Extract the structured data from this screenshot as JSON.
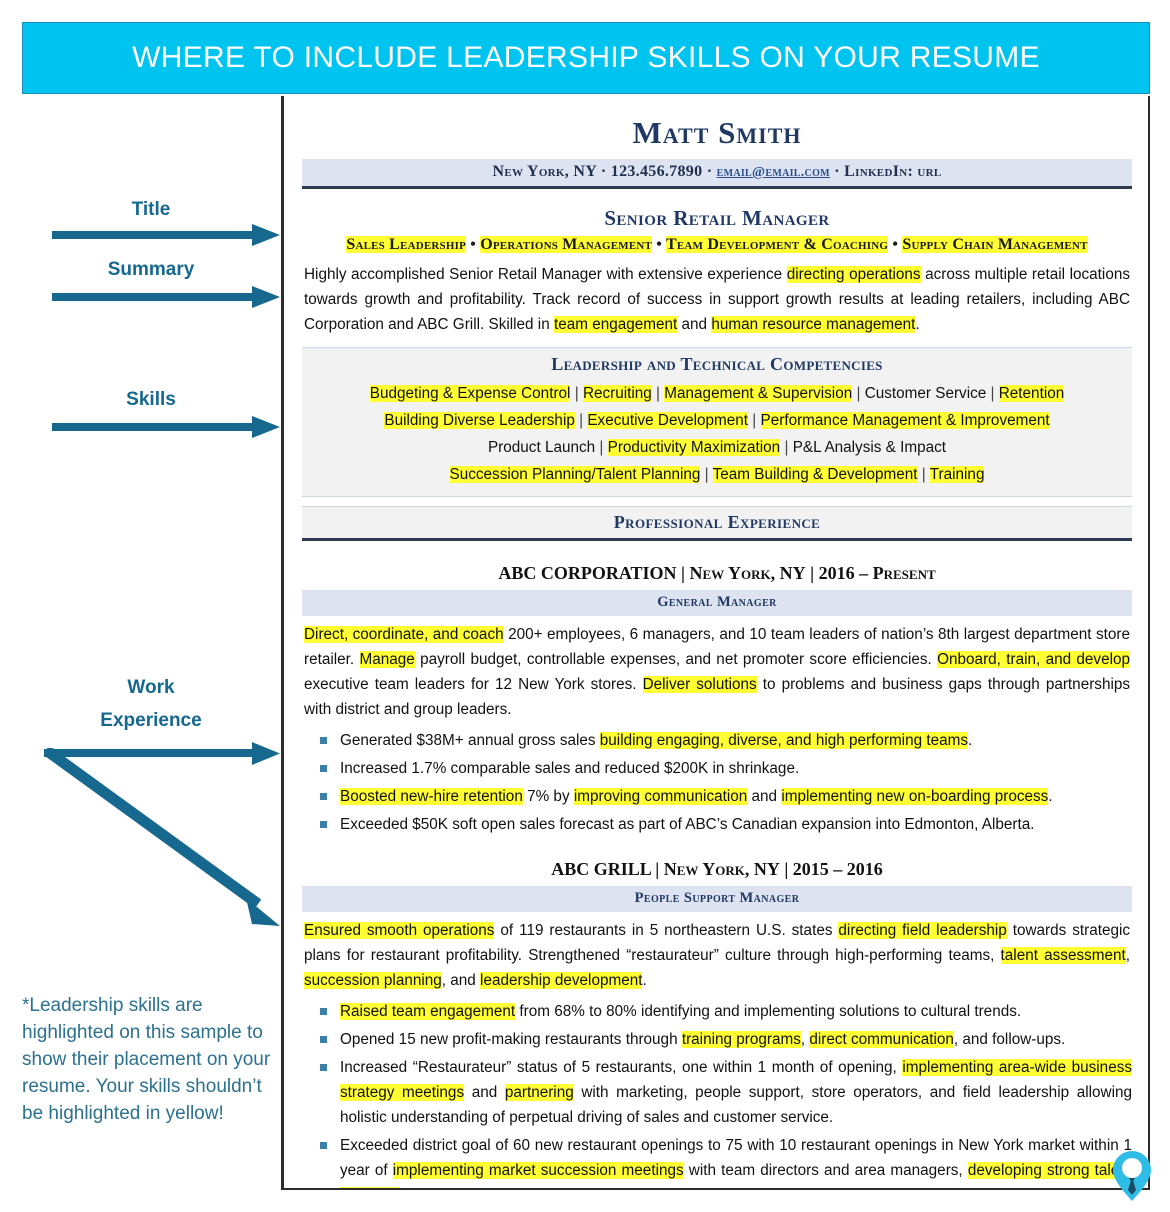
{
  "banner": {
    "title": "WHERE TO INCLUDE LEADERSHIP SKILLS ON YOUR RESUME",
    "bg_color": "#00c4f0",
    "text_color": "#ffffff"
  },
  "annotations": {
    "accent_color": "#15688f",
    "labels": [
      {
        "text": "Title"
      },
      {
        "text": "Summary"
      },
      {
        "text": "Skills"
      },
      {
        "text": "Work"
      },
      {
        "text": "Experience"
      }
    ],
    "note": "*Leadership skills are highlighted on this sample to show their placement on your resume. Your skills shouldn’t be highlighted in yellow!"
  },
  "resume": {
    "name": "Matt Smith",
    "contact": {
      "location": "New York, NY",
      "sep": "·",
      "phone": "123.456.7890",
      "email": "email@email.com",
      "linkedin": "LinkedIn: url"
    },
    "job_title": "Senior Retail Manager",
    "specialties": [
      {
        "text": "Sales Leadership",
        "highlight": true
      },
      {
        "text": "Operations Management",
        "highlight": true
      },
      {
        "text": "Team Development & Coaching",
        "highlight": true
      },
      {
        "text": "Supply Chain Management",
        "highlight": true
      }
    ],
    "specialty_sep": "•",
    "summary_parts": [
      {
        "text": "Highly accomplished Senior Retail Manager with extensive experience ",
        "highlight": false
      },
      {
        "text": "directing operations",
        "highlight": true
      },
      {
        "text": " across multiple retail locations towards growth and profitability. Track record of success in support growth results at leading retailers, including ABC Corporation and ABC Grill. Skilled in ",
        "highlight": false
      },
      {
        "text": "team engagement",
        "highlight": true
      },
      {
        "text": " and ",
        "highlight": false
      },
      {
        "text": "human resource management",
        "highlight": true
      },
      {
        "text": ".",
        "highlight": false
      }
    ],
    "competencies": {
      "heading": "Leadership and Technical Competencies",
      "rows": [
        [
          {
            "text": "Budgeting & Expense Control",
            "highlight": true
          },
          {
            "text": "Recruiting",
            "highlight": true
          },
          {
            "text": "Management & Supervision",
            "highlight": true
          },
          {
            "text": "Customer Service",
            "highlight": false
          },
          {
            "text": "Retention",
            "highlight": true
          }
        ],
        [
          {
            "text": "Building Diverse Leadership",
            "highlight": true
          },
          {
            "text": "Executive Development",
            "highlight": true
          },
          {
            "text": "Performance Management & Improvement",
            "highlight": true
          }
        ],
        [
          {
            "text": "Product Launch",
            "highlight": false
          },
          {
            "text": "Productivity Maximization",
            "highlight": true
          },
          {
            "text": "P&L Analysis & Impact",
            "highlight": false
          }
        ],
        [
          {
            "text": "Succession Planning/Talent Planning",
            "highlight": true
          },
          {
            "text": "Team Building & Development",
            "highlight": true
          },
          {
            "text": "Training",
            "highlight": true
          }
        ]
      ],
      "separator": "|"
    },
    "experience_heading": "Professional Experience",
    "jobs": [
      {
        "company": "ABC CORPORATION",
        "location": "New York, NY",
        "dates": "2016 – Present",
        "role": "General Manager",
        "paragraph_parts": [
          {
            "text": "Direct, coordinate, and coach",
            "highlight": true
          },
          {
            "text": " 200+ employees, 6 managers, and 10 team leaders of nation’s 8th largest department store retailer. ",
            "highlight": false
          },
          {
            "text": "Manage",
            "highlight": true
          },
          {
            "text": " payroll budget, controllable expenses, and net promoter score efficiencies. ",
            "highlight": false
          },
          {
            "text": "Onboard, train, and develop",
            "highlight": true
          },
          {
            "text": " executive team leaders for 12 New York stores. ",
            "highlight": false
          },
          {
            "text": "Deliver solutions",
            "highlight": true
          },
          {
            "text": " to problems and business gaps through partnerships with district and group leaders.",
            "highlight": false
          }
        ],
        "bullets": [
          [
            {
              "text": "Generated $38M+ annual gross sales ",
              "highlight": false
            },
            {
              "text": "building engaging, diverse, and high performing teams",
              "highlight": true
            },
            {
              "text": ".",
              "highlight": false
            }
          ],
          [
            {
              "text": "Increased 1.7% comparable sales and reduced $200K in shrinkage.",
              "highlight": false
            }
          ],
          [
            {
              "text": "Boosted new-hire retention",
              "highlight": true
            },
            {
              "text": " 7% by ",
              "highlight": false
            },
            {
              "text": "improving communication",
              "highlight": true
            },
            {
              "text": " and ",
              "highlight": false
            },
            {
              "text": "implementing new on-boarding process",
              "highlight": true
            },
            {
              "text": ".",
              "highlight": false
            }
          ],
          [
            {
              "text": "Exceeded $50K soft open sales forecast as part of ABC’s Canadian expansion into Edmonton, Alberta.",
              "highlight": false
            }
          ]
        ]
      },
      {
        "company": "ABC GRILL",
        "location": "New York, NY",
        "dates": "2015 – 2016",
        "role": "People Support Manager",
        "paragraph_parts": [
          {
            "text": "Ensured smooth operations",
            "highlight": true
          },
          {
            "text": " of 119 restaurants in 5 northeastern U.S. states ",
            "highlight": false
          },
          {
            "text": "directing field leadership",
            "highlight": true
          },
          {
            "text": " towards strategic plans for restaurant profitability. Strengthened “restaurateur” culture through high-performing teams, ",
            "highlight": false
          },
          {
            "text": "talent assessment",
            "highlight": true
          },
          {
            "text": ", ",
            "highlight": false
          },
          {
            "text": "succession planning",
            "highlight": true
          },
          {
            "text": ", and ",
            "highlight": false
          },
          {
            "text": "leadership development",
            "highlight": true
          },
          {
            "text": ".",
            "highlight": false
          }
        ],
        "bullets": [
          [
            {
              "text": "Raised team engagement",
              "highlight": true
            },
            {
              "text": " from 68% to 80% identifying and implementing solutions to cultural trends.",
              "highlight": false
            }
          ],
          [
            {
              "text": "Opened 15 new profit-making restaurants through ",
              "highlight": false
            },
            {
              "text": "training programs",
              "highlight": true
            },
            {
              "text": ", ",
              "highlight": false
            },
            {
              "text": "direct communication",
              "highlight": true
            },
            {
              "text": ", and follow-ups.",
              "highlight": false
            }
          ],
          [
            {
              "text": "Increased “Restaurateur” status of 5 restaurants, one within 1 month of opening, ",
              "highlight": false
            },
            {
              "text": "implementing area-wide business strategy meetings",
              "highlight": true
            },
            {
              "text": " and ",
              "highlight": false
            },
            {
              "text": "partnering",
              "highlight": true
            },
            {
              "text": " with marketing, people support, store operators, and field leadership allowing holistic understanding of perpetual driving of sales and customer service.",
              "highlight": false
            }
          ],
          [
            {
              "text": "Exceeded district goal of 60 new restaurant openings to 75 with 10 restaurant openings in New York market within 1 year of ",
              "highlight": false
            },
            {
              "text": "implementing market succession meetings",
              "highlight": true
            },
            {
              "text": " with team directors and area managers, ",
              "highlight": false
            },
            {
              "text": "developing strong talent pipelines",
              "highlight": true
            },
            {
              "text": ".",
              "highlight": false
            }
          ]
        ]
      }
    ]
  },
  "logo": {
    "name": "location-pin-necktie-logo",
    "color": "#2fbde8",
    "tie_color": "#1b4b63"
  },
  "colors": {
    "highlight_yellow": "#ffff33",
    "navy": "#1f3864",
    "band_blue": "#dde3f0",
    "band_gray": "#f2f2f2"
  }
}
